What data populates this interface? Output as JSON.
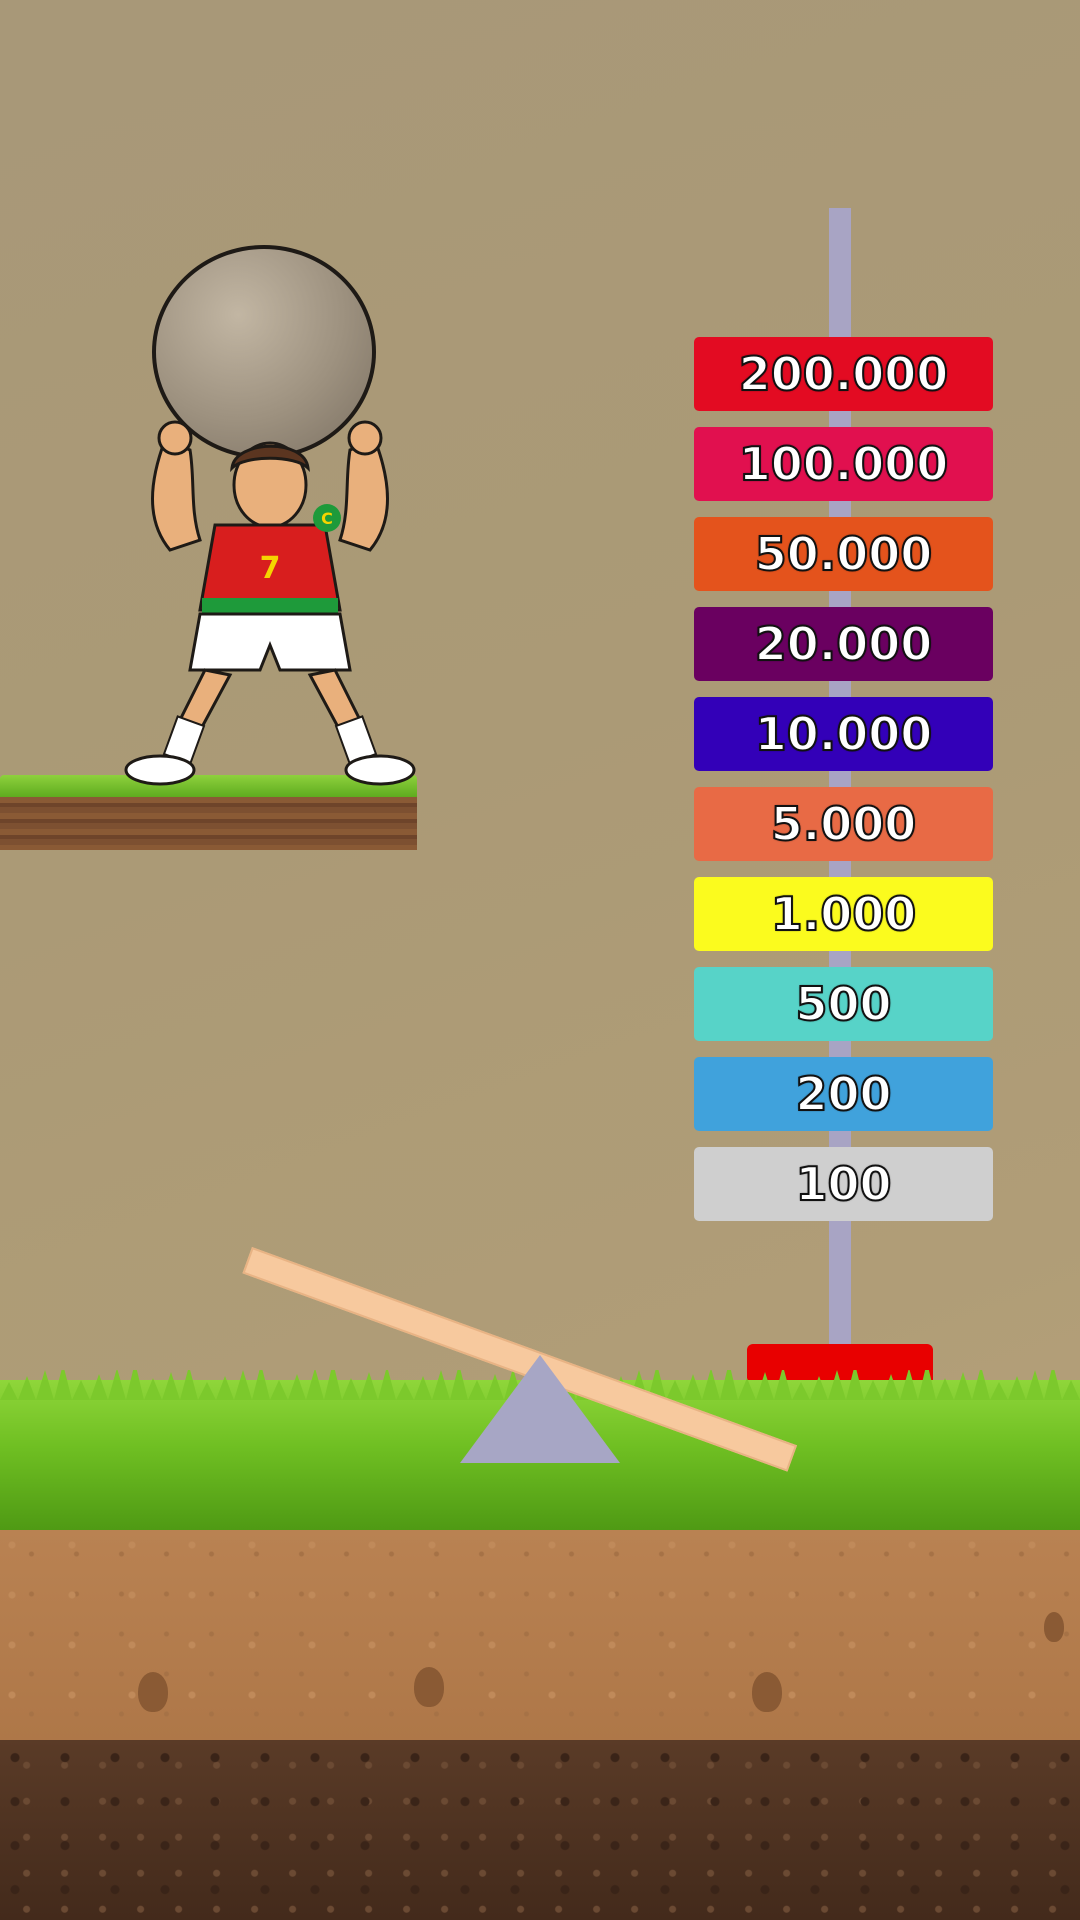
{
  "game": {
    "tiers": [
      {
        "label": "200.000",
        "color": "#e30b22"
      },
      {
        "label": "100.000",
        "color": "#e1104f"
      },
      {
        "label": "50.000",
        "color": "#e4531c"
      },
      {
        "label": "20.000",
        "color": "#6a0060"
      },
      {
        "label": "10.000",
        "color": "#3300b8"
      },
      {
        "label": "5.000",
        "color": "#e86a45"
      },
      {
        "label": "1.000",
        "color": "#fbfb1e"
      },
      {
        "label": "500",
        "color": "#57d3c8"
      },
      {
        "label": "200",
        "color": "#40a2dc"
      },
      {
        "label": "100",
        "color": "#cfcfcf"
      }
    ],
    "character": {
      "jersey_number": "7",
      "armband_letter": "C"
    },
    "colors": {
      "pole": "#a8a4c4",
      "base": "#e80000",
      "plank": "#f7c99e",
      "fulcrum": "#a7a6c5"
    }
  }
}
